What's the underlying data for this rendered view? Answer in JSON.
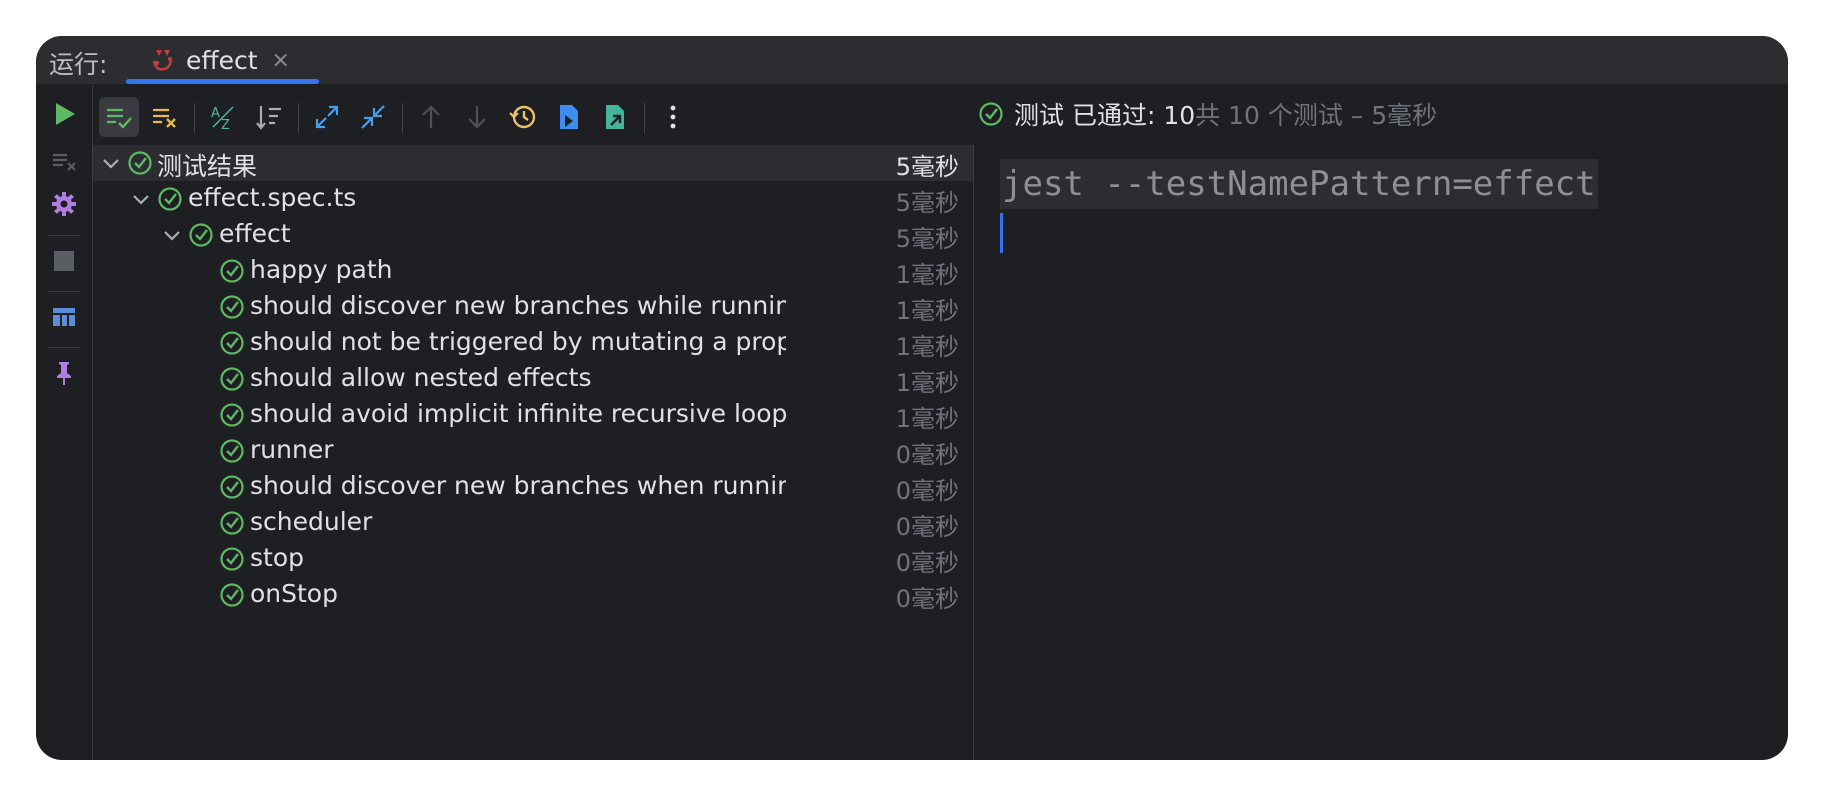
{
  "tabbar": {
    "run_label": "运行:",
    "tab_title": "effect",
    "close_glyph": "×"
  },
  "toolbar": {
    "buttons": [
      "show-passed-icon",
      "show-ignored-icon",
      "sort-alpha-icon",
      "sort-duration-icon",
      "expand-all-icon",
      "collapse-all-icon",
      "previous-test-icon",
      "next-test-icon",
      "history-icon",
      "import-tests-icon",
      "export-tests-icon",
      "more-options-icon"
    ]
  },
  "status": {
    "passed_text": "测试 已通过: 10",
    "total_text": "共 10 个测试 – 5毫秒"
  },
  "tree": {
    "root": {
      "label": "测试结果",
      "time": "5毫秒"
    },
    "file": {
      "label": "effect.spec.ts",
      "time": "5毫秒"
    },
    "suite": {
      "label": "effect",
      "time": "5毫秒"
    },
    "tests": [
      {
        "label": "happy path",
        "time": "1毫秒"
      },
      {
        "label": "should discover new branches while running automatically",
        "time": "1毫秒"
      },
      {
        "label": "should not be triggered by mutating a property, which is used in an inactive branch",
        "time": "1毫秒"
      },
      {
        "label": "should allow nested effects",
        "time": "1毫秒"
      },
      {
        "label": "should avoid implicit infinite recursive loops with itself",
        "time": "1毫秒"
      },
      {
        "label": "runner",
        "time": "0毫秒"
      },
      {
        "label": "should discover new branches when running manually",
        "time": "0毫秒"
      },
      {
        "label": "scheduler",
        "time": "0毫秒"
      },
      {
        "label": "stop",
        "time": "0毫秒"
      },
      {
        "label": "onStop",
        "time": "0毫秒"
      }
    ]
  },
  "console": {
    "command": "jest --testNamePattern=effect"
  },
  "colors": {
    "pass_green": "#5fb865",
    "run_green": "#5fb865",
    "accent_blue": "#3574f0",
    "warn_yellow": "#e8b84a",
    "purple": "#b07de0"
  }
}
